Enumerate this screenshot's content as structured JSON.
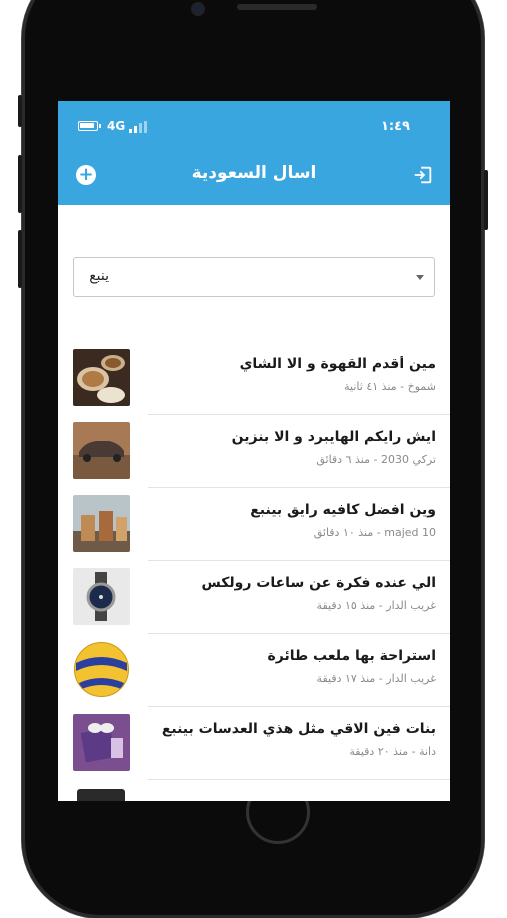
{
  "status_bar": {
    "network": "4G",
    "time": "١:٤٩"
  },
  "header": {
    "title": "اسال السعودية",
    "add_icon": "plus-circle-icon",
    "exit_icon": "exit-icon"
  },
  "filter": {
    "selected": "ينبع"
  },
  "posts": [
    {
      "title": "مين أقدم القهوة و الا الشاي",
      "meta": "شموخ - منذ ٤١ ثانية",
      "thumb": "coffee-cups"
    },
    {
      "title": "ايش رايكم الهايبرد و الا بنزين",
      "meta": "تركي 2030 - منذ ٦ دقائق",
      "thumb": "car"
    },
    {
      "title": "وين افضل كافيه رايق بينبع",
      "meta": "majed 10 - منذ ١٠ دقائق",
      "thumb": "iced-drinks"
    },
    {
      "title": "الي عنده فكرة عن ساعات رولكس",
      "meta": "غريب الدار - منذ ١٥ دقيقة",
      "thumb": "watch"
    },
    {
      "title": "استراحة بها ملعب طائرة",
      "meta": "غريب الدار - منذ ١٧ دقيقة",
      "thumb": "volleyball"
    },
    {
      "title": "بنات فين الاقي مثل هذي العدسات بينبع",
      "meta": "دانة - منذ ٢٠ دقيقة",
      "thumb": "contact-lenses"
    },
    {
      "title": "",
      "meta": "",
      "thumb": "card"
    }
  ]
}
